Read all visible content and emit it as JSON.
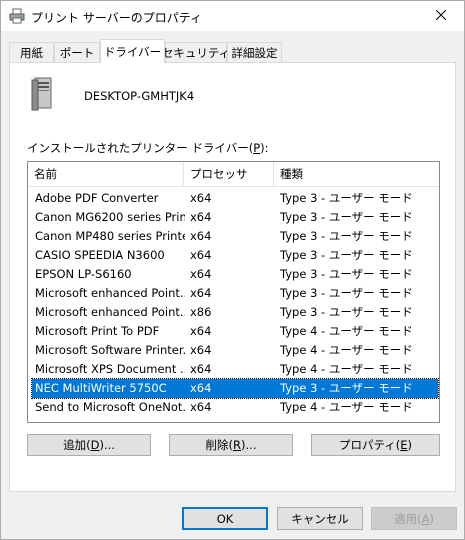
{
  "window": {
    "title": "プリント サーバーのプロパティ"
  },
  "tabs": [
    {
      "label": "用紙",
      "active": false
    },
    {
      "label": "ポート",
      "active": false
    },
    {
      "label": "ドライバー",
      "active": true
    },
    {
      "label": "セキュリティ",
      "active": false
    },
    {
      "label": "詳細設定",
      "active": false
    }
  ],
  "server": {
    "name": "DESKTOP-GMHTJK4"
  },
  "drivers": {
    "label_prefix": "インストールされたプリンター ドライバー(",
    "label_key": "P",
    "label_suffix": "):",
    "columns": [
      "名前",
      "プロセッサ",
      "種類"
    ],
    "rows": [
      {
        "name": "Adobe PDF Converter",
        "processor": "x64",
        "type": "Type 3 - ユーザー モード"
      },
      {
        "name": "Canon MG6200 series Prin...",
        "processor": "x64",
        "type": "Type 3 - ユーザー モード"
      },
      {
        "name": "Canon MP480 series Printer",
        "processor": "x64",
        "type": "Type 3 - ユーザー モード"
      },
      {
        "name": "CASIO SPEEDIA N3600",
        "processor": "x64",
        "type": "Type 3 - ユーザー モード"
      },
      {
        "name": "EPSON LP-S6160",
        "processor": "x64",
        "type": "Type 3 - ユーザー モード"
      },
      {
        "name": "Microsoft enhanced Point...",
        "processor": "x64",
        "type": "Type 3 - ユーザー モード"
      },
      {
        "name": "Microsoft enhanced Point...",
        "processor": "x86",
        "type": "Type 3 - ユーザー モード"
      },
      {
        "name": "Microsoft Print To PDF",
        "processor": "x64",
        "type": "Type 4 - ユーザー モード"
      },
      {
        "name": "Microsoft Software Printer...",
        "processor": "x64",
        "type": "Type 4 - ユーザー モード"
      },
      {
        "name": "Microsoft XPS Document ...",
        "processor": "x64",
        "type": "Type 4 - ユーザー モード"
      },
      {
        "name": "NEC MultiWriter 5750C",
        "processor": "x64",
        "type": "Type 3 - ユーザー モード",
        "selected": true
      },
      {
        "name": "Send to Microsoft OneNot...",
        "processor": "x64",
        "type": "Type 4 - ユーザー モード"
      }
    ]
  },
  "actions": {
    "add": {
      "prefix": "追加(",
      "key": "D",
      "suffix": ")..."
    },
    "remove": {
      "prefix": "削除(",
      "key": "R",
      "suffix": ")..."
    },
    "properties": {
      "prefix": "プロパティ(",
      "key": "E",
      "suffix": ")"
    }
  },
  "footer": {
    "ok": "OK",
    "cancel": "キャンセル",
    "apply": {
      "prefix": "適用(",
      "key": "A",
      "suffix": ")"
    }
  },
  "colors": {
    "selection": "#0078d7",
    "panel": "#ffffff",
    "window": "#f0f0f0"
  },
  "icons": {
    "title": "printer-icon",
    "close": "close-icon",
    "server": "computer-tower-icon"
  }
}
